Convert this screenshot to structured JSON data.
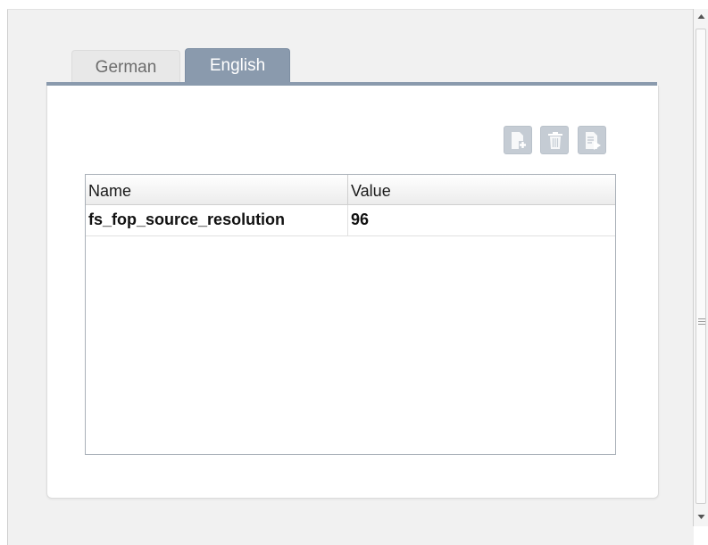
{
  "tabs": [
    {
      "label": "German",
      "active": false
    },
    {
      "label": "English",
      "active": true
    }
  ],
  "toolbar": {
    "buttons": [
      {
        "icon": "add-row-icon",
        "enabled": false
      },
      {
        "icon": "trash-icon",
        "enabled": false
      },
      {
        "icon": "edit-row-icon",
        "enabled": false
      }
    ]
  },
  "table": {
    "columns": [
      "Name",
      "Value"
    ],
    "rows": [
      {
        "name": "fs_fop_source_resolution",
        "value": "96"
      }
    ]
  },
  "colors": {
    "tab_active": "#8a9aad",
    "button_disabled": "#c5ccd4",
    "table_border": "#a9b0b8"
  }
}
